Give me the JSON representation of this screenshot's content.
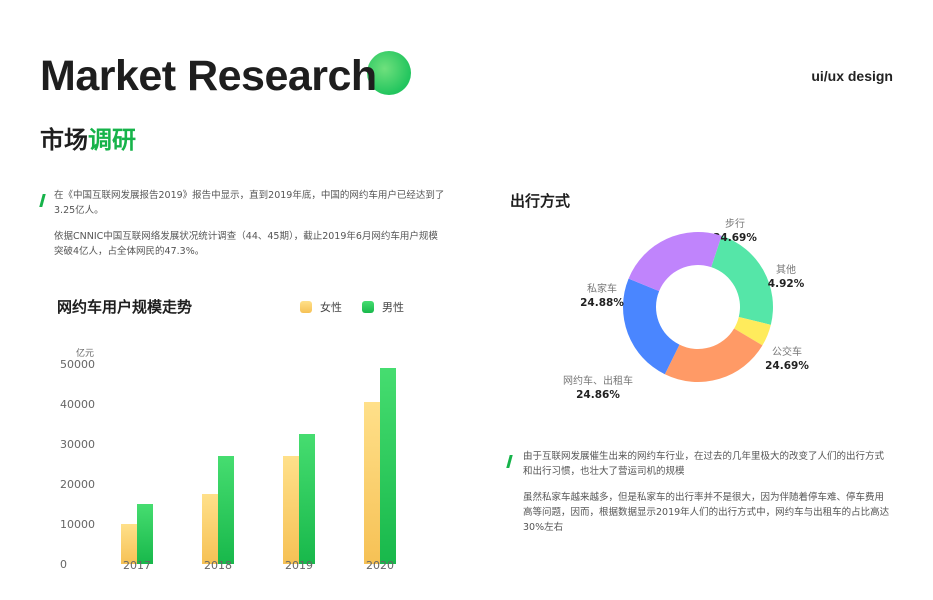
{
  "header": {
    "title_en": "Market Research",
    "tag": "ui/ux design",
    "title_cn_a": "市场",
    "title_cn_b": "调研"
  },
  "intro": {
    "p1": "在《中国互联网发展报告2019》报告中显示，直到2019年底，中国的网约车用户已经达到了3.25亿人。",
    "p2": "依据CNNIC中国互联网络发展状况统计调查（44、45期），截止2019年6月网约车用户规模突破4亿人，占全体网民的47.3%。"
  },
  "travel_text": {
    "p1": "由于互联网发展催生出来的网约车行业，在过去的几年里极大的改变了人们的出行方式和出行习惯，也壮大了营运司机的规模",
    "p2": "虽然私家车越来越多，但是私家车的出行率并不是很大，因为伴随着停车难、停车费用高等问题，因而，根据数据显示2019年人们的出行方式中，网约车与出租车的占比高达30%左右"
  },
  "colors": {
    "accent": "#16b34a",
    "female_top": "#ffe08a",
    "female_bottom": "#f6c155",
    "male_top": "#46dd70",
    "male_bottom": "#18b84b"
  },
  "chart_data": [
    {
      "type": "bar",
      "title": "网约车用户规模走势",
      "ylabel": "亿元",
      "categories": [
        "2017",
        "2018",
        "2019",
        "2020"
      ],
      "series": [
        {
          "name": "女性",
          "values": [
            10000,
            17500,
            27000,
            40500
          ]
        },
        {
          "name": "男性",
          "values": [
            15000,
            27000,
            32500,
            49000
          ]
        }
      ],
      "yticks": [
        0,
        10000,
        20000,
        30000,
        40000,
        50000
      ],
      "ylim": [
        0,
        50000
      ],
      "grid": false,
      "legend": "top-right"
    },
    {
      "type": "pie",
      "title": "出行方式",
      "donut": true,
      "slices": [
        {
          "name": "步行",
          "value": 24.69,
          "label": "24.69%",
          "color": "#55e6a8"
        },
        {
          "name": "其他",
          "value": 4.92,
          "label": "4.92%",
          "color": "#ffeb5c"
        },
        {
          "name": "公交车",
          "value": 24.69,
          "label": "24.69%",
          "color": "#ff9a66"
        },
        {
          "name": "网约车、出租车",
          "value": 24.86,
          "label": "24.86%",
          "color": "#4a86ff"
        },
        {
          "name": "私家车",
          "value": 24.88,
          "label": "24.88%",
          "color": "#c084fc"
        }
      ]
    }
  ]
}
